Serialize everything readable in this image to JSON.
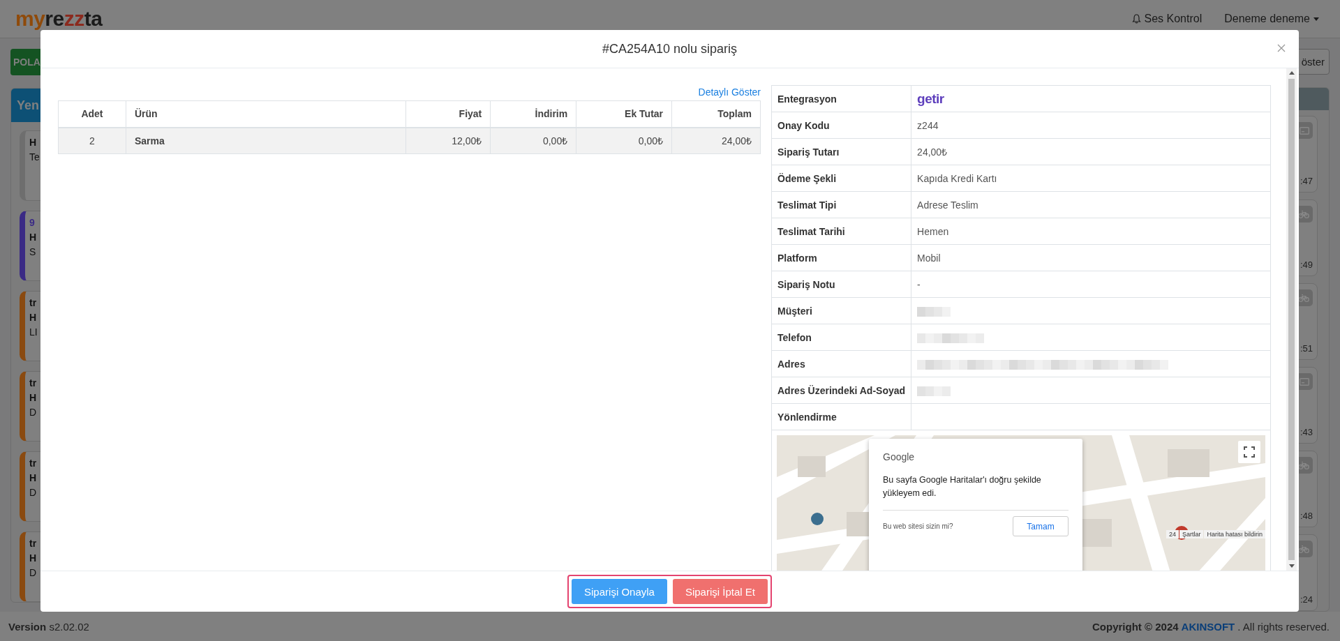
{
  "header": {
    "logo": [
      {
        "text": "my",
        "color": "#8f4a0a"
      },
      {
        "text": "re",
        "color": "#1a1a1a"
      },
      {
        "text": "zz",
        "color": "#8b2a1e"
      },
      {
        "text": "ta",
        "color": "#1a1a1a"
      }
    ],
    "sound": "Ses Kontrol",
    "user": "Deneme deneme"
  },
  "toolbar": {
    "left_button": "POLA",
    "right_button": "öster"
  },
  "left_panel": {
    "title": "Yen",
    "cards": [
      {
        "color": "#6e6e6e",
        "lines": [
          "H",
          "Te"
        ]
      },
      {
        "color": "#3a2a85",
        "lines": [
          "9",
          "H",
          "S"
        ]
      },
      {
        "color": "#8a4a10",
        "lines": [
          "tr",
          "H",
          "LI"
        ]
      },
      {
        "color": "#8a4a10",
        "lines": [
          "tr",
          "H",
          "D"
        ]
      },
      {
        "color": "#8a4a10",
        "lines": [
          "tr",
          "H",
          "D"
        ]
      },
      {
        "color": "#8a4a10",
        "lines": [
          "tr",
          "H",
          "D"
        ]
      }
    ]
  },
  "right_panel": {
    "cards": [
      {
        "kind": "card",
        "time": ":47"
      },
      {
        "kind": "bike",
        "time": ":49"
      },
      {
        "kind": "bike",
        "time": ":51"
      },
      {
        "kind": "card",
        "time": ":43"
      },
      {
        "kind": "bike",
        "time": ":48"
      },
      {
        "kind": "bike",
        "time": ":24"
      }
    ]
  },
  "footer": {
    "version_label": "Version",
    "version": "s2.02.02",
    "copyright": "Copyright © 2024",
    "company": "AKINSOFT",
    "rights": ". All rights reserved."
  },
  "modal": {
    "title": "#CA254A10 nolu sipariş",
    "detail_link": "Detaylı Göster",
    "columns": [
      "Adet",
      "Ürün",
      "Fiyat",
      "İndirim",
      "Ek Tutar",
      "Toplam"
    ],
    "rows": [
      [
        "2",
        "Sarma",
        "12,00₺",
        "0,00₺",
        "0,00₺",
        "24,00₺"
      ]
    ],
    "info": [
      {
        "label": "Entegrasyon",
        "kind": "logo",
        "value": "getir"
      },
      {
        "label": "Onay Kodu",
        "kind": "text",
        "value": "z244"
      },
      {
        "label": "Sipariş Tutarı",
        "kind": "text",
        "value": "24,00₺"
      },
      {
        "label": "Ödeme Şekli",
        "kind": "text",
        "value": "Kapıda Kredi Kartı"
      },
      {
        "label": "Teslimat Tipi",
        "kind": "text",
        "value": "Adrese Teslim"
      },
      {
        "label": "Teslimat Tarihi",
        "kind": "text",
        "value": "Hemen"
      },
      {
        "label": "Platform",
        "kind": "text",
        "value": "Mobil"
      },
      {
        "label": "Sipariş Notu",
        "kind": "text",
        "value": "-"
      },
      {
        "label": "Müşteri",
        "kind": "hidden"
      },
      {
        "label": "Telefon",
        "kind": "hidden"
      },
      {
        "label": "Adres",
        "kind": "hidden"
      },
      {
        "label": "Adres Üzerindeki Ad-Soyad",
        "kind": "hidden"
      },
      {
        "label": "Yönlendirme",
        "kind": "empty"
      }
    ],
    "map": {
      "kind": "picture",
      "dialog": {
        "brand": "Google",
        "message": "Bu sayfa Google Haritalar'ı doğru şekilde yükleyem edi.",
        "question": "Bu web sitesi sizin mi?",
        "button": "Tamam"
      },
      "attribution": [
        "24",
        "Şartlar",
        "Harita hatası bildirin"
      ]
    },
    "buttons": [
      {
        "label": "Siparişi Onayla",
        "kind": "confirm"
      },
      {
        "label": "Siparişi İptal Et",
        "kind": "cancel"
      }
    ]
  }
}
